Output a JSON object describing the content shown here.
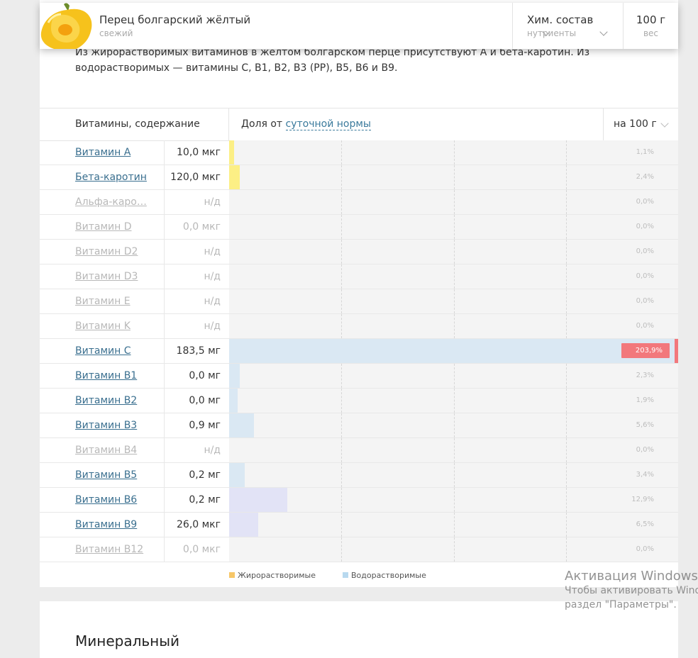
{
  "header": {
    "product_name": "Перец болгарский жёлтый",
    "product_sub": "свежий",
    "chem_label": "Хим. состав",
    "chem_sub": "нутриенты",
    "weight_value": "100 г",
    "weight_sub": "вес"
  },
  "intro_text": "Из жирорастворимых витаминов в желтом болгарском перце присутствуют A и бета-каротин. Из водорастворимых — витамины C, B1, B2, B3 (PP), B5, B6 и B9.",
  "table": {
    "title": "Витамины, содержание",
    "share_prefix": "Доля от",
    "share_link": "суточной нормы",
    "per_label": "на 100 г"
  },
  "chart_data": {
    "type": "bar",
    "categories": [
      "Витамин A",
      "Бета-каротин",
      "Альфа-каро…",
      "Витамин D",
      "Витамин D2",
      "Витамин D3",
      "Витамин E",
      "Витамин K",
      "Витамин C",
      "Витамин B1",
      "Витамин B2",
      "Витамин B3",
      "Витамин B4",
      "Витамин B5",
      "Витамин B6",
      "Витамин B9",
      "Витамин B12"
    ],
    "amounts": [
      "10,0 мкг",
      "120,0 мкг",
      "н/д",
      "0,0 мкг",
      "н/д",
      "н/д",
      "н/д",
      "н/д",
      "183,5 мг",
      "0,0 мг",
      "0,0 мг",
      "0,9 мг",
      "н/д",
      "0,2 мг",
      "0,2 мг",
      "26,0 мкг",
      "0,0 мкг"
    ],
    "values": [
      1.1,
      2.4,
      0.0,
      0.0,
      0.0,
      0.0,
      0.0,
      0.0,
      203.9,
      2.3,
      1.9,
      5.6,
      0.0,
      3.4,
      12.9,
      6.5,
      0.0
    ],
    "labels": [
      "1,1%",
      "2,4%",
      "0,0%",
      "0,0%",
      "0,0%",
      "0,0%",
      "0,0%",
      "0,0%",
      "203,9%",
      "2,3%",
      "1,9%",
      "5,6%",
      "0,0%",
      "3,4%",
      "12,9%",
      "6,5%",
      "0,0%"
    ],
    "active": [
      true,
      true,
      false,
      false,
      false,
      false,
      false,
      false,
      true,
      true,
      true,
      true,
      false,
      true,
      true,
      true,
      false
    ],
    "groups": [
      "fat",
      "fat",
      "fat",
      "fat",
      "fat",
      "fat",
      "fat",
      "fat",
      "water",
      "water",
      "water",
      "water",
      "water",
      "water",
      "water",
      "water",
      "water"
    ],
    "group_colors": {
      "fat": "#fcef85",
      "water": "#dae8f3",
      "water_b": "#e2e3f6"
    },
    "ylim": [
      0,
      100
    ],
    "grid": true,
    "legend": [
      {
        "label": "Жирорастворимые",
        "color": "#f7c768"
      },
      {
        "label": "Водорастворимые",
        "color": "#b8d9ef"
      }
    ],
    "over_color": "#f2787c"
  },
  "next_heading": "Минеральный",
  "watermark": {
    "title": "Активация Windows",
    "line1": "Чтобы активировать Windo",
    "line2": "раздел \"Параметры\"."
  }
}
